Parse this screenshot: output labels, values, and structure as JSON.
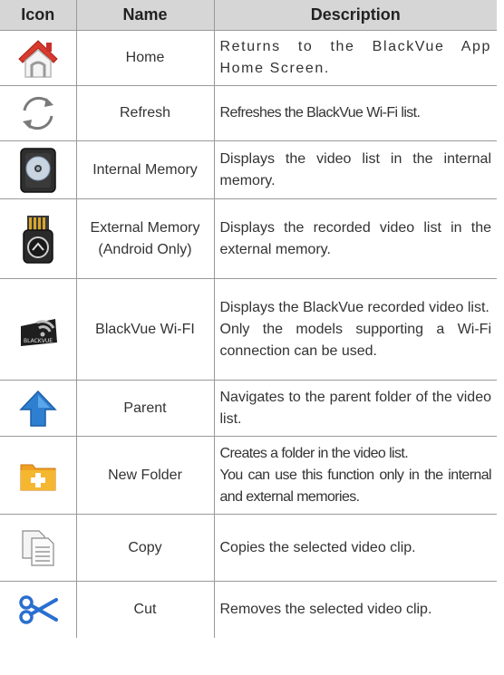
{
  "header": {
    "icon": "Icon",
    "name": "Name",
    "description": "Description"
  },
  "rows": [
    {
      "icon": "home-icon",
      "name": "Home",
      "desc": [
        "Returns to the BlackVue App Home Screen."
      ]
    },
    {
      "icon": "refresh-icon",
      "name": "Refresh",
      "desc": [
        "Refreshes the BlackVue Wi-Fi list."
      ]
    },
    {
      "icon": "internal-memory-icon",
      "name": "Internal Memory",
      "desc": [
        "Displays the video list in the internal memory."
      ]
    },
    {
      "icon": "external-memory-icon",
      "name": "External Memory (Android Only)",
      "desc": [
        "Displays the recorded video list in the external memory."
      ]
    },
    {
      "icon": "blackvue-wifi-icon",
      "name": "BlackVue Wi-FI",
      "logo_text": "BLACKVUE",
      "desc": [
        "Displays the BlackVue recorded video list.",
        "Only the models supporting a Wi-Fi connection can be used."
      ]
    },
    {
      "icon": "parent-arrow-icon",
      "name": "Parent",
      "desc": [
        "Navigates to the parent folder of the video list."
      ]
    },
    {
      "icon": "new-folder-icon",
      "name": "New Folder",
      "desc": [
        "Creates a folder in the video list.",
        "You can use this function only in the internal and external memories."
      ]
    },
    {
      "icon": "copy-icon",
      "name": "Copy",
      "desc": [
        "Copies the selected video clip."
      ]
    },
    {
      "icon": "cut-icon",
      "name": "Cut",
      "desc": [
        "Removes the selected video clip."
      ]
    }
  ]
}
